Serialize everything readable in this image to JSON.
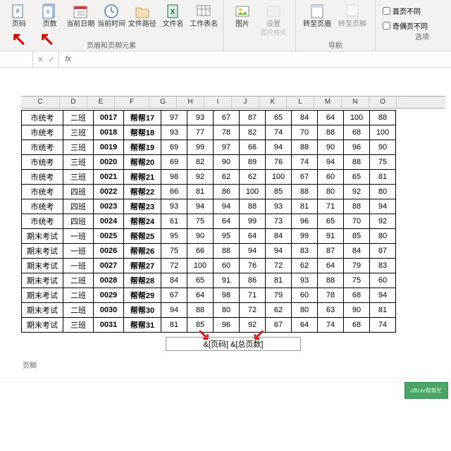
{
  "ribbon": {
    "groups": [
      {
        "label": "页眉和页脚元素",
        "items": [
          {
            "name": "page-number-button",
            "label": "页码"
          },
          {
            "name": "page-count-button",
            "label": "页数"
          },
          {
            "name": "current-date-button",
            "label": "当前日期"
          },
          {
            "name": "current-time-button",
            "label": "当前时间"
          },
          {
            "name": "file-path-button",
            "label": "文件路径"
          },
          {
            "name": "file-name-button",
            "label": "文件名"
          },
          {
            "name": "sheet-name-button",
            "label": "工作表名"
          }
        ]
      },
      {
        "label": "",
        "items": [
          {
            "name": "picture-button",
            "label": "图片",
            "sub": ""
          },
          {
            "name": "picture-format-button",
            "label": "设置",
            "sub": "图片格式",
            "disabled": true
          }
        ]
      },
      {
        "label": "导航",
        "items": [
          {
            "name": "goto-header-button",
            "label": "转至页眉"
          },
          {
            "name": "goto-footer-button",
            "label": "转至页脚",
            "disabled": true
          }
        ]
      }
    ],
    "checks": [
      {
        "name": "diff-first-check",
        "label": "首页不同"
      },
      {
        "name": "diff-oddeven-check",
        "label": "奇偶页不同"
      }
    ],
    "optionsLabel": "选项"
  },
  "columns": [
    "C",
    "D",
    "E",
    "F",
    "G",
    "H",
    "I",
    "J",
    "K",
    "L",
    "M",
    "N",
    "O"
  ],
  "rows": [
    [
      "市统考",
      "二班",
      "0017",
      "帮帮17",
      "97",
      "93",
      "67",
      "87",
      "65",
      "84",
      "64",
      "100",
      "88"
    ],
    [
      "市统考",
      "三班",
      "0018",
      "帮帮18",
      "93",
      "77",
      "78",
      "82",
      "74",
      "70",
      "88",
      "68",
      "100"
    ],
    [
      "市统考",
      "三班",
      "0019",
      "帮帮19",
      "69",
      "99",
      "97",
      "66",
      "94",
      "88",
      "90",
      "96",
      "90"
    ],
    [
      "市统考",
      "三班",
      "0020",
      "帮帮20",
      "69",
      "82",
      "90",
      "89",
      "76",
      "74",
      "94",
      "88",
      "75"
    ],
    [
      "市统考",
      "三班",
      "0021",
      "帮帮21",
      "98",
      "92",
      "62",
      "62",
      "100",
      "67",
      "60",
      "65",
      "81"
    ],
    [
      "市统考",
      "四班",
      "0022",
      "帮帮22",
      "66",
      "81",
      "86",
      "100",
      "85",
      "88",
      "80",
      "92",
      "80"
    ],
    [
      "市统考",
      "四班",
      "0023",
      "帮帮23",
      "93",
      "94",
      "94",
      "88",
      "93",
      "81",
      "71",
      "88",
      "94"
    ],
    [
      "市统考",
      "四班",
      "0024",
      "帮帮24",
      "61",
      "75",
      "64",
      "99",
      "73",
      "96",
      "65",
      "70",
      "92"
    ],
    [
      "期末考试",
      "一班",
      "0025",
      "帮帮25",
      "95",
      "90",
      "95",
      "64",
      "84",
      "99",
      "91",
      "85",
      "80"
    ],
    [
      "期末考试",
      "一班",
      "0026",
      "帮帮26",
      "75",
      "66",
      "88",
      "94",
      "94",
      "83",
      "87",
      "84",
      "87"
    ],
    [
      "期末考试",
      "一班",
      "0027",
      "帮帮27",
      "72",
      "100",
      "60",
      "76",
      "72",
      "62",
      "64",
      "79",
      "83"
    ],
    [
      "期末考试",
      "二班",
      "0028",
      "帮帮28",
      "84",
      "65",
      "91",
      "86",
      "81",
      "93",
      "88",
      "75",
      "60"
    ],
    [
      "期末考试",
      "二班",
      "0029",
      "帮帮29",
      "67",
      "64",
      "98",
      "71",
      "79",
      "60",
      "78",
      "68",
      "94"
    ],
    [
      "期末考试",
      "二班",
      "0030",
      "帮帮30",
      "94",
      "88",
      "80",
      "72",
      "62",
      "80",
      "63",
      "90",
      "81"
    ],
    [
      "期末考试",
      "三班",
      "0031",
      "帮帮31",
      "81",
      "85",
      "96",
      "92",
      "67",
      "64",
      "74",
      "68",
      "74"
    ]
  ],
  "footer": {
    "text": "&[页码] &[总页数]",
    "label": "页脚"
  },
  "badge": "officer帮帮忙"
}
